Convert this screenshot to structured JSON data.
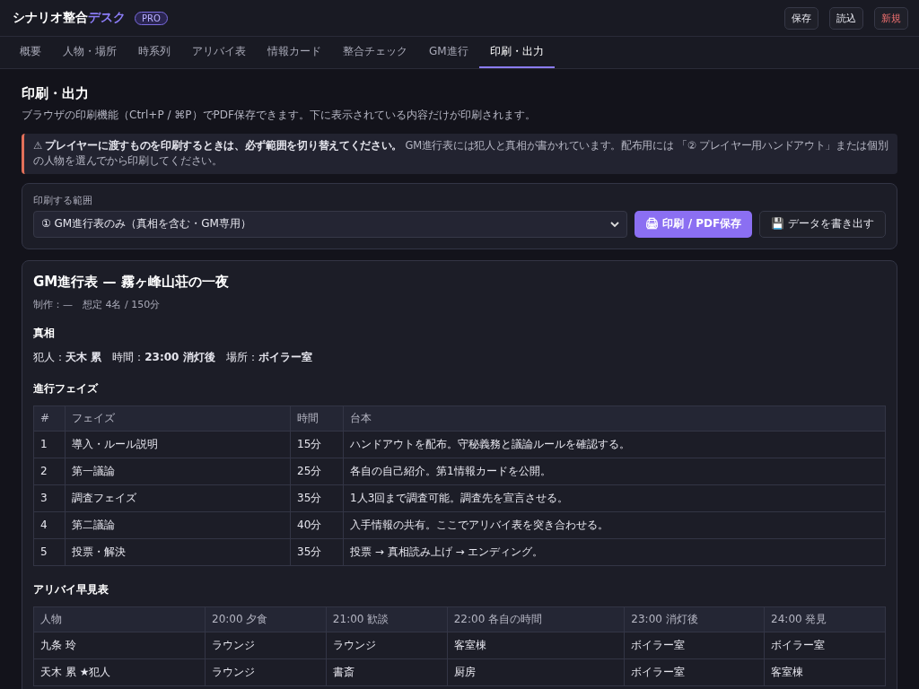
{
  "header": {
    "brand": "シナリオ整合",
    "brand_accent": "デスク",
    "badge": "PRO",
    "buttons": [
      {
        "label": "保存",
        "kind": "normal"
      },
      {
        "label": "読込",
        "kind": "normal"
      },
      {
        "label": "新規",
        "kind": "danger"
      }
    ]
  },
  "tabs": [
    {
      "label": "概要",
      "selected": false
    },
    {
      "label": "人物・場所",
      "selected": false
    },
    {
      "label": "時系列",
      "selected": false
    },
    {
      "label": "アリバイ表",
      "selected": false
    },
    {
      "label": "情報カード",
      "selected": false
    },
    {
      "label": "整合チェック",
      "selected": false
    },
    {
      "label": "GM進行",
      "selected": false
    },
    {
      "label": "印刷・出力",
      "selected": true
    }
  ],
  "page": {
    "title": "印刷・出力",
    "description": "ブラウザの印刷機能（Ctrl+P / ⌘P）でPDF保存できます。下に表示されている内容だけが印刷されます。",
    "warning": "⚠ **プレイヤーに渡すものを印刷するときは、必ず範囲を切り替えてください。** GM進行表には犯人と真相が書かれています。配布用には 「② プレイヤー用ハンドアウト」または個別の人物を選んでから印刷してください。"
  },
  "print_range": {
    "label": "印刷する範囲",
    "value": "① GM進行表のみ（真相を含む・GM専用）",
    "print_button": "🖨 印刷 / PDF保存",
    "export_button": "💾 データを書き出す"
  },
  "preview": {
    "title": "GM進行表 — 霧ヶ峰山荘の一夜",
    "meta": "制作：—　想定 4名 / 150分",
    "truth_heading": "真相",
    "truth": "犯人：**天木 累**　時間：**23:00 消灯後**　場所：**ボイラー室**",
    "phases_heading": "進行フェイズ",
    "phases": {
      "columns": [
        "#",
        "フェイズ",
        "時間",
        "台本"
      ],
      "rows": [
        [
          "1",
          "導入・ルール説明",
          "15分",
          "ハンドアウトを配布。守秘義務と議論ルールを確認する。"
        ],
        [
          "2",
          "第一議論",
          "25分",
          "各自の自己紹介。第1情報カードを公開。"
        ],
        [
          "3",
          "調査フェイズ",
          "35分",
          "1人3回まで調査可能。調査先を宣言させる。"
        ],
        [
          "4",
          "第二議論",
          "40分",
          "入手情報の共有。ここでアリバイ表を突き合わせる。"
        ],
        [
          "5",
          "投票・解決",
          "35分",
          "投票 → 真相読み上げ → エンディング。"
        ]
      ]
    },
    "alibi_heading": "アリバイ早見表",
    "alibi": {
      "columns": [
        "人物",
        "20:00 夕食",
        "21:00 歓談",
        "22:00 各自の時間",
        "23:00 消灯後",
        "24:00 発見"
      ],
      "rows": [
        [
          "九条 玲",
          "ラウンジ",
          "ラウンジ",
          "客室棟",
          "ボイラー室",
          "ボイラー室"
        ],
        [
          "天木 累 ★犯人",
          "ラウンジ",
          "書斎",
          "厨房",
          "ボイラー室",
          "客室棟"
        ]
      ]
    }
  }
}
